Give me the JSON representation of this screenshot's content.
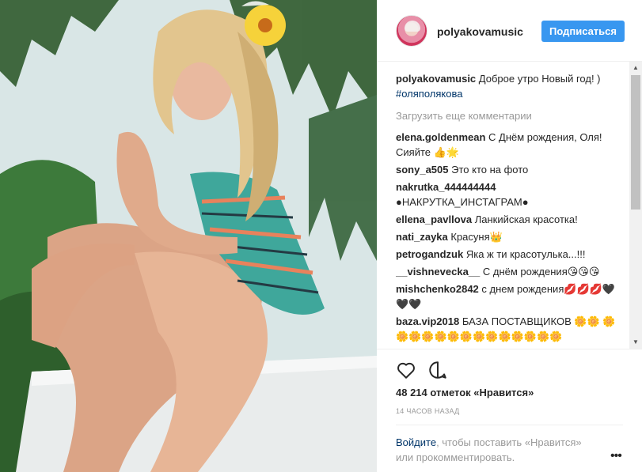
{
  "post": {
    "username": "polyakovamusic",
    "follow_label": "Подписаться",
    "caption_author": "polyakovamusic",
    "caption_text": " Доброе утро Новый год! ) ",
    "caption_hashtag": "#оляполякова",
    "load_more": "Загрузить еще комментарии",
    "comments": [
      {
        "author": "elena.goldenmean",
        "text": " С Днём рождения, Оля! Сияйте 👍🌟"
      },
      {
        "author": "sony_a505",
        "text": " Это кто на фото"
      },
      {
        "author": "nakrutka_444444444",
        "text": " ●НАКРУТКА_ИНСТАГРАМ●"
      },
      {
        "author": "ellena_pavllova",
        "text": " Ланкийская красотка!"
      },
      {
        "author": "nati_zayka",
        "text": " Красуня👑"
      },
      {
        "author": "petrogandzuk",
        "text": " Яка ж ти красотулька...!!!"
      },
      {
        "author": "__vishnevecka__",
        "text": " С днём рождения😘😘😘"
      },
      {
        "author": "mishchenko2842",
        "text": " с днем рождения💋💋💋🖤🖤🖤"
      },
      {
        "author": "baza.vip2018",
        "text": " БАЗА ПОСТАВЩИКОВ 🌼🌼 🌼🌼🌼🌼🌼🌼🌼🌼🌼🌼🌼🌼🌼🌼"
      }
    ],
    "likes": "48 214 отметок «Нравится»",
    "timestamp": "14 ЧАСОВ НАЗАД",
    "login_link": "Войдите",
    "login_text": ", чтобы поставить «Нравится» или прокомментировать.",
    "more_glyph": "•••"
  },
  "icons": {
    "like": "heart-outline-icon",
    "comment": "speech-bubble-icon",
    "more": "ellipsis-icon"
  },
  "colors": {
    "accent": "#3897f0",
    "link": "#003569",
    "muted": "#999999",
    "text": "#262626"
  }
}
